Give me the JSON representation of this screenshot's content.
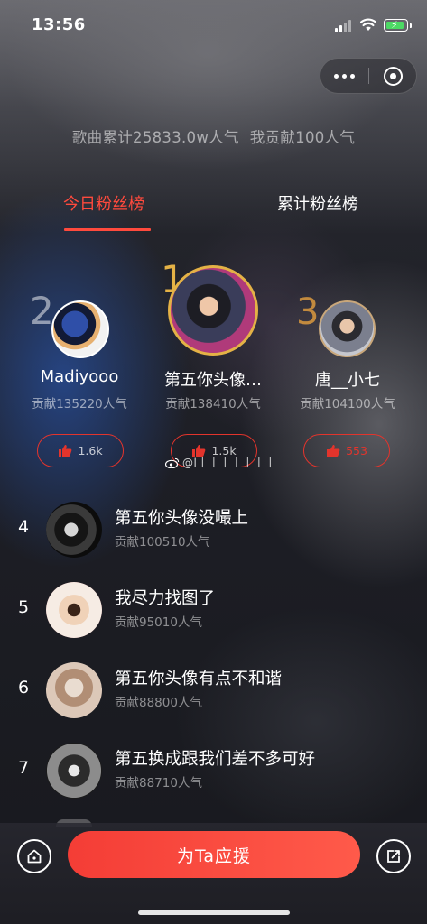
{
  "status_bar": {
    "time": "13:56"
  },
  "capsule": {
    "more_icon": "more-dots-icon",
    "close_icon": "target-close-icon"
  },
  "summary": {
    "song_total": "歌曲累计25833.0w人气",
    "my_contribution": "我贡献100人气"
  },
  "tabs": [
    {
      "label": "今日粉丝榜",
      "active": true
    },
    {
      "label": "累计粉丝榜",
      "active": false
    }
  ],
  "podium": [
    {
      "rank": "2",
      "name": "Madiyooo",
      "contribution": "贡献135220人气",
      "likes": "1.6k"
    },
    {
      "rank": "1",
      "name": "第五你头像…",
      "contribution": "贡献138410人气",
      "likes": "1.5k"
    },
    {
      "rank": "3",
      "name": "唐__小七",
      "contribution": "贡献104100人气",
      "likes": "553"
    }
  ],
  "watermark": "@l丨丨丨丨丨丨丨",
  "list": [
    {
      "rank": "4",
      "name": "第五你头像没嘬上",
      "contribution": "贡献100510人气"
    },
    {
      "rank": "5",
      "name": "我尽力找图了",
      "contribution": "贡献95010人气"
    },
    {
      "rank": "6",
      "name": "第五你头像有点不和谐",
      "contribution": "贡献88800人气"
    },
    {
      "rank": "7",
      "name": "第五换成跟我们差不多可好",
      "contribution": "贡献88710人气"
    }
  ],
  "bottom_bar": {
    "support_label": "为Ta应援",
    "home_icon": "home-icon",
    "share_icon": "share-icon"
  },
  "colors": {
    "accent": "#f43d36",
    "gold": "#e4b246",
    "bronze": "#c28a3e"
  }
}
